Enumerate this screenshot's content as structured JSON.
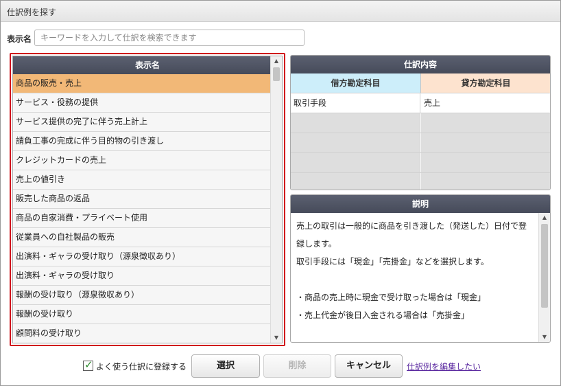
{
  "window": {
    "title": "仕訳例を探す"
  },
  "search": {
    "label": "表示名",
    "placeholder": "キーワードを入力して仕訳を検索できます",
    "value": ""
  },
  "list": {
    "header": "表示名",
    "selected_index": 0,
    "items": [
      "商品の販売・売上",
      "サービス・役務の提供",
      "サービス提供の完了に伴う売上計上",
      "請負工事の完成に伴う目的物の引き渡し",
      "クレジットカードの売上",
      "売上の値引き",
      "販売した商品の返品",
      "商品の自家消費・プライベート使用",
      "従業員への自社製品の販売",
      "出演料・ギャラの受け取り（源泉徴収あり）",
      "出演料・ギャラの受け取り",
      "報酬の受け取り（源泉徴収あり）",
      "報酬の受け取り",
      "顧問料の受け取り"
    ]
  },
  "journal": {
    "header": "仕訳内容",
    "debit_header": "借方勘定科目",
    "credit_header": "貸方勘定科目",
    "rows": [
      {
        "debit": "取引手段",
        "credit": "売上"
      },
      {
        "debit": "",
        "credit": ""
      },
      {
        "debit": "",
        "credit": ""
      },
      {
        "debit": "",
        "credit": ""
      },
      {
        "debit": "",
        "credit": ""
      }
    ]
  },
  "description": {
    "header": "説明",
    "lines": [
      "売上の取引は一般的に商品を引き渡した（発送した）日付で登",
      "録します。",
      "取引手段には「現金」「売掛金」などを選択します。",
      "",
      "・商品の売上時に現金で受け取った場合は「現金」",
      "・売上代金が後日入金される場合は「売掛金」"
    ]
  },
  "footer": {
    "register_checkbox_label": "よく使う仕訳に登録する",
    "register_checked": true,
    "select_button": "選択",
    "delete_button": "削除",
    "cancel_button": "キャンセル",
    "edit_link": "仕訳例を編集したい"
  },
  "colors": {
    "selection": "#f2b877",
    "panel_header": "#4f5463",
    "debit_header_bg": "#cdeefa",
    "credit_header_bg": "#fde3cf",
    "focus_border": "#d0121b",
    "link": "#5b2aa0"
  }
}
